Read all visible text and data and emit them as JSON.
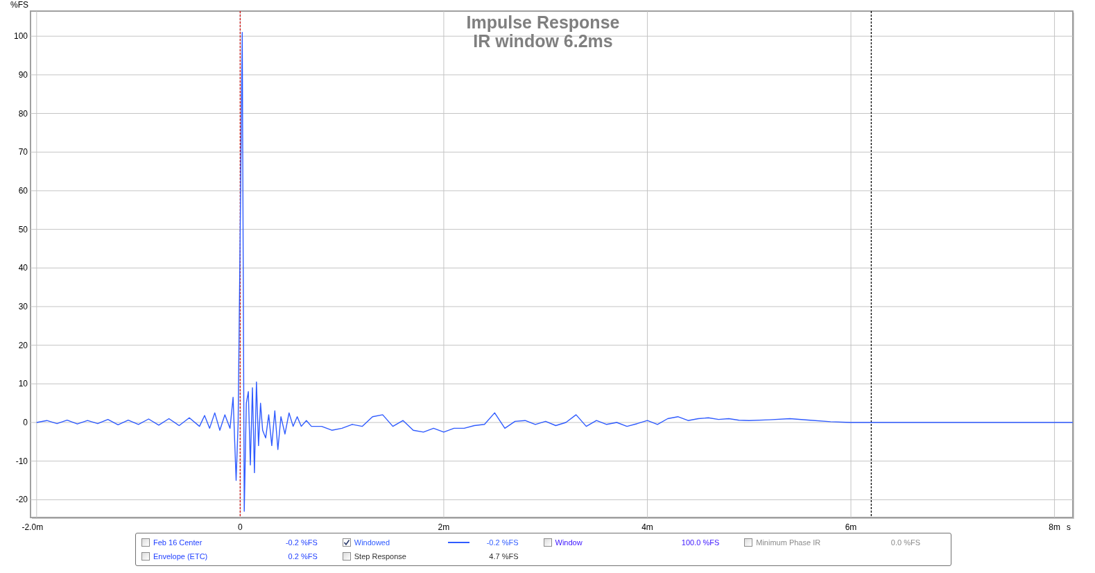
{
  "chart": {
    "subtitle": "IR window 6.2ms",
    "chart_data": {
      "type": "line",
      "title": "Impulse Response",
      "xlabel": "s",
      "ylabel": "%FS",
      "xlim": [
        -2.06,
        8.18
      ],
      "ylim": [
        -24.6,
        106.5
      ],
      "xticks": [
        {
          "value": -2,
          "label": "-2.0m"
        },
        {
          "value": 0,
          "label": "0"
        },
        {
          "value": 2,
          "label": "2m"
        },
        {
          "value": 4,
          "label": "4m"
        },
        {
          "value": 6,
          "label": "6m"
        },
        {
          "value": 8,
          "label": "8m"
        }
      ],
      "yticks": [
        -20,
        -10,
        0,
        10,
        20,
        30,
        40,
        50,
        60,
        70,
        80,
        90,
        100
      ],
      "x": [
        -2.0,
        -1.9,
        -1.8,
        -1.7,
        -1.6,
        -1.5,
        -1.4,
        -1.3,
        -1.2,
        -1.1,
        -1.0,
        -0.9,
        -0.8,
        -0.7,
        -0.6,
        -0.5,
        -0.4,
        -0.35,
        -0.3,
        -0.25,
        -0.2,
        -0.15,
        -0.1,
        -0.07,
        -0.04,
        -0.02,
        0.0,
        0.02,
        0.04,
        0.06,
        0.08,
        0.1,
        0.12,
        0.14,
        0.16,
        0.18,
        0.2,
        0.22,
        0.25,
        0.28,
        0.31,
        0.34,
        0.37,
        0.4,
        0.44,
        0.48,
        0.52,
        0.56,
        0.6,
        0.65,
        0.7,
        0.8,
        0.9,
        1.0,
        1.1,
        1.2,
        1.3,
        1.4,
        1.5,
        1.6,
        1.7,
        1.8,
        1.9,
        2.0,
        2.1,
        2.2,
        2.3,
        2.4,
        2.5,
        2.6,
        2.7,
        2.8,
        2.9,
        3.0,
        3.1,
        3.2,
        3.3,
        3.4,
        3.5,
        3.6,
        3.7,
        3.8,
        3.9,
        4.0,
        4.1,
        4.2,
        4.3,
        4.4,
        4.5,
        4.6,
        4.7,
        4.8,
        4.9,
        5.0,
        5.2,
        5.4,
        5.6,
        5.8,
        6.0,
        6.5,
        7.0,
        7.5,
        8.0,
        8.18
      ],
      "series": [
        {
          "color": "#2f5bff",
          "values": [
            0,
            0.5,
            -0.3,
            0.6,
            -0.4,
            0.5,
            -0.3,
            0.8,
            -0.6,
            0.6,
            -0.5,
            0.9,
            -0.7,
            1.0,
            -0.8,
            1.2,
            -1.0,
            1.8,
            -1.5,
            2.5,
            -2,
            2.0,
            -1.5,
            6.5,
            -15,
            0,
            50,
            101,
            -23,
            5,
            8,
            -11,
            9,
            -13,
            10.5,
            -6,
            5,
            -2,
            -4,
            2,
            -6,
            3,
            -7,
            1.5,
            -3,
            2.5,
            -1,
            1.5,
            -1,
            0.5,
            -1,
            -1,
            -2,
            -1.5,
            -0.5,
            -1,
            1.5,
            2,
            -1,
            0.5,
            -2,
            -2.5,
            -1.5,
            -2.5,
            -1.5,
            -1.5,
            -0.8,
            -0.5,
            2.5,
            -1.5,
            0.3,
            0.5,
            -0.5,
            0.3,
            -0.8,
            0,
            2,
            -1,
            0.5,
            -0.5,
            0,
            -1,
            -0.3,
            0.5,
            -0.5,
            1,
            1.5,
            0.5,
            1,
            1.2,
            0.8,
            1,
            0.6,
            0.5,
            0.7,
            1,
            0.6,
            0.2,
            0,
            0,
            0,
            0,
            0,
            0
          ]
        }
      ],
      "grid": true,
      "ref_lines": [
        {
          "axis": "x",
          "value": 0,
          "color": "#d01010"
        },
        {
          "axis": "x",
          "value": 6.2,
          "color": "#000000"
        }
      ]
    }
  },
  "legend": {
    "rows": [
      [
        {
          "label": "Feb 16 Center",
          "value": "-0.2 %FS",
          "checked": false,
          "color": "#1f3fff",
          "show_line": false
        },
        {
          "label": "Windowed",
          "value": "-0.2 %FS",
          "checked": true,
          "color": "#2f5bff",
          "show_line": true
        },
        {
          "label": "Window",
          "value": "100.0 %FS",
          "checked": false,
          "color": "#3a12ff",
          "show_line": false
        },
        {
          "label": "Minimum Phase IR",
          "value": "0.0 %FS",
          "checked": false,
          "color": "#8a8a8a",
          "show_line": false
        }
      ],
      [
        {
          "label": "Envelope (ETC)",
          "value": "0.2 %FS",
          "checked": false,
          "color": "#1f3fff",
          "show_line": false
        },
        {
          "label": "Step Response",
          "value": "4.7 %FS",
          "checked": false,
          "color": "#303030",
          "show_line": false
        }
      ]
    ]
  }
}
